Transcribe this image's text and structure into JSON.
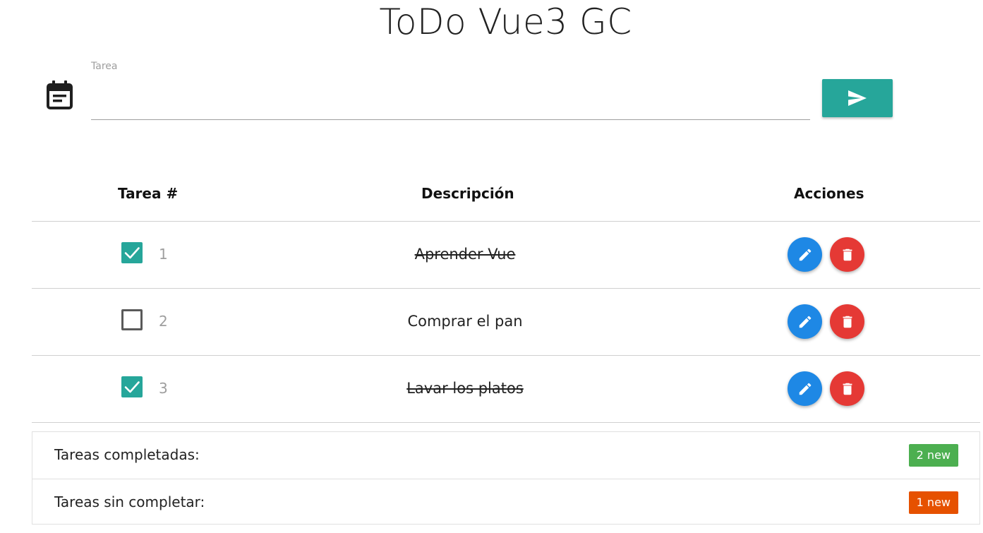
{
  "app": {
    "title": "ToDo Vue3 GC"
  },
  "input": {
    "label": "Tarea",
    "value": ""
  },
  "icons": {
    "calendar": "event-note-icon",
    "send": "send-icon",
    "check": "check-icon",
    "edit": "pencil-icon",
    "delete": "trash-icon"
  },
  "colors": {
    "accent": "#26a69a",
    "edit": "#1e88e5",
    "delete": "#e53935",
    "badge_completed": "#4caf50",
    "badge_pending": "#e65100"
  },
  "table": {
    "headers": {
      "number": "Tarea #",
      "description": "Descripción",
      "actions": "Acciones"
    },
    "rows": [
      {
        "number": "1",
        "description": "Aprender Vue",
        "completed": true
      },
      {
        "number": "2",
        "description": "Comprar el pan",
        "completed": false
      },
      {
        "number": "3",
        "description": "Lavar los platos",
        "completed": true
      }
    ]
  },
  "summary": {
    "completed_label": "Tareas completadas:",
    "completed_badge": "2 new",
    "pending_label": "Tareas sin completar:",
    "pending_badge": "1 new"
  }
}
